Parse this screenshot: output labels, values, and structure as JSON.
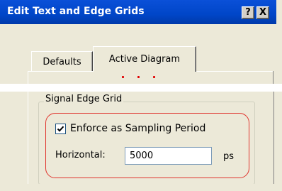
{
  "window": {
    "title": "Edit Text and Edge Grids",
    "help_button": "?",
    "close_button": "X"
  },
  "tabs": [
    {
      "label": "Defaults",
      "active": false
    },
    {
      "label": "Active Diagram",
      "active": true
    }
  ],
  "signal_edge_grid": {
    "group_label": "Signal Edge Grid",
    "enforce_label": "Enforce as Sampling Period",
    "enforce_checked": true,
    "horizontal_label": "Horizontal:",
    "horizontal_value": "5000",
    "unit": "ps"
  },
  "colors": {
    "title_bar": "#0046c8",
    "dialog_bg": "#ece9d8",
    "highlight": "#e0352e"
  }
}
